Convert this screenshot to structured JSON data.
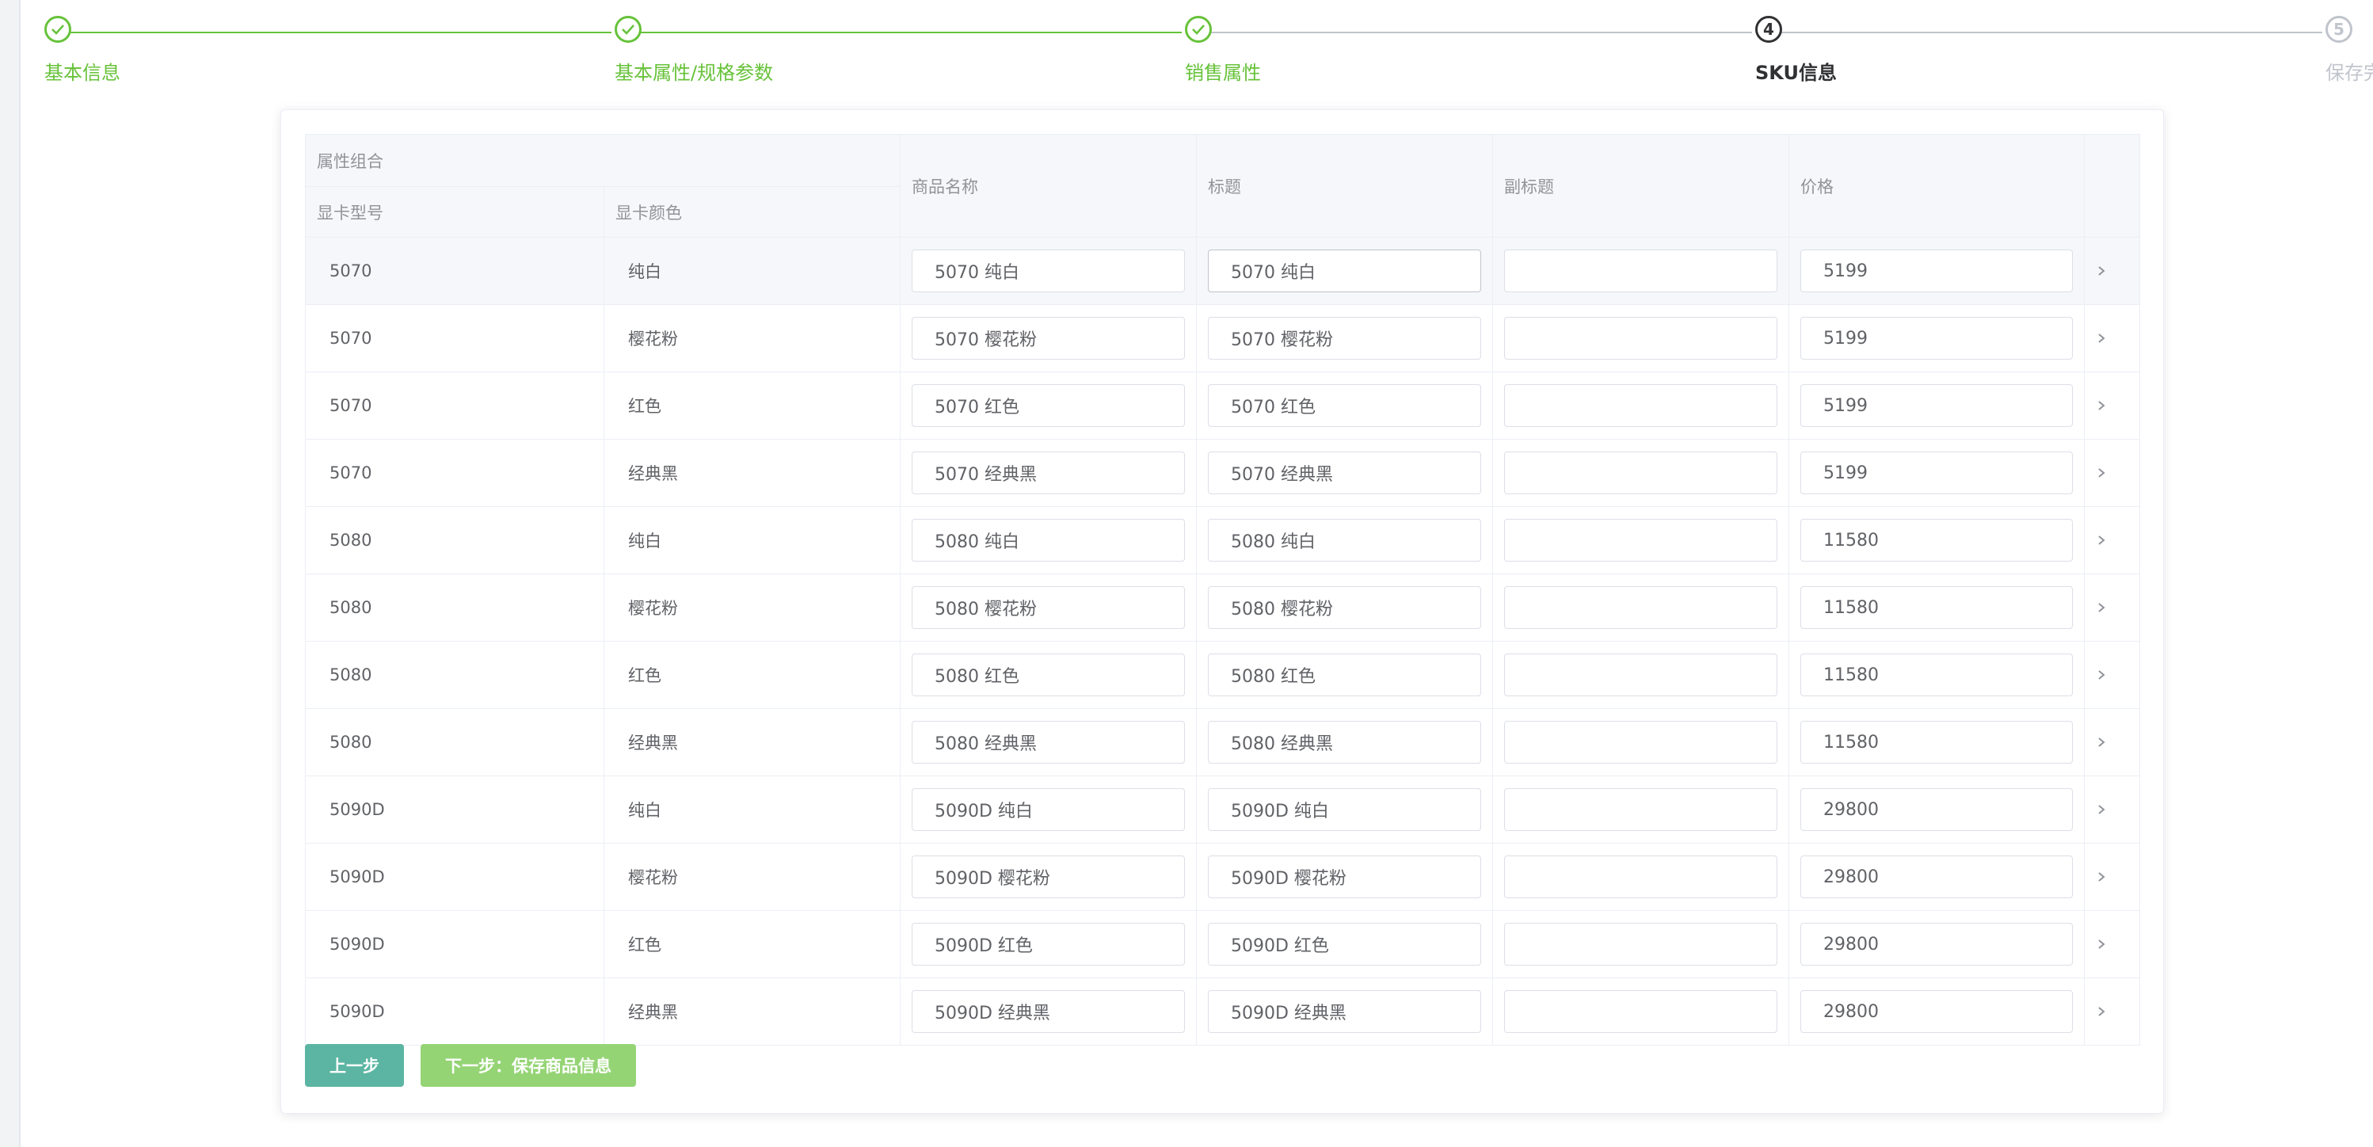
{
  "steps": [
    {
      "number": "1",
      "title": "基本信息",
      "status": "done"
    },
    {
      "number": "2",
      "title": "基本属性/规格参数",
      "status": "done"
    },
    {
      "number": "3",
      "title": "销售属性",
      "status": "done"
    },
    {
      "number": "4",
      "title": "SKU信息",
      "status": "process"
    },
    {
      "number": "5",
      "title": "保存完",
      "status": "wait"
    }
  ],
  "table": {
    "group_header": "属性组合",
    "attr_headers": [
      "显卡型号",
      "显卡颜色"
    ],
    "col_name": "商品名称",
    "col_title": "标题",
    "col_subtitle": "副标题",
    "col_price": "价格",
    "expand_icon": "chevron-right-icon",
    "rows": [
      {
        "model": "5070",
        "color": "纯白",
        "name": "5070 纯白",
        "title": "5070 纯白",
        "subtitle": "",
        "price": "5199"
      },
      {
        "model": "5070",
        "color": "樱花粉",
        "name": "5070 樱花粉",
        "title": "5070 樱花粉",
        "subtitle": "",
        "price": "5199"
      },
      {
        "model": "5070",
        "color": "红色",
        "name": "5070 红色",
        "title": "5070 红色",
        "subtitle": "",
        "price": "5199"
      },
      {
        "model": "5070",
        "color": "经典黑",
        "name": "5070 经典黑",
        "title": "5070 经典黑",
        "subtitle": "",
        "price": "5199"
      },
      {
        "model": "5080",
        "color": "纯白",
        "name": "5080 纯白",
        "title": "5080 纯白",
        "subtitle": "",
        "price": "11580"
      },
      {
        "model": "5080",
        "color": "樱花粉",
        "name": "5080 樱花粉",
        "title": "5080 樱花粉",
        "subtitle": "",
        "price": "11580"
      },
      {
        "model": "5080",
        "color": "红色",
        "name": "5080 红色",
        "title": "5080 红色",
        "subtitle": "",
        "price": "11580"
      },
      {
        "model": "5080",
        "color": "经典黑",
        "name": "5080 经典黑",
        "title": "5080 经典黑",
        "subtitle": "",
        "price": "11580"
      },
      {
        "model": "5090D",
        "color": "纯白",
        "name": "5090D 纯白",
        "title": "5090D 纯白",
        "subtitle": "",
        "price": "29800"
      },
      {
        "model": "5090D",
        "color": "樱花粉",
        "name": "5090D 樱花粉",
        "title": "5090D 樱花粉",
        "subtitle": "",
        "price": "29800"
      },
      {
        "model": "5090D",
        "color": "红色",
        "name": "5090D 红色",
        "title": "5090D 红色",
        "subtitle": "",
        "price": "29800"
      },
      {
        "model": "5090D",
        "color": "经典黑",
        "name": "5090D 经典黑",
        "title": "5090D 经典黑",
        "subtitle": "",
        "price": "29800"
      }
    ]
  },
  "buttons": {
    "prev_label": "上一步",
    "next_label": "下一步：保存商品信息"
  },
  "colors": {
    "success": "#67c23a",
    "process": "#303133",
    "wait": "#c0c4cc",
    "prev_button": "#5bb5a2",
    "next_button": "#95d475"
  }
}
